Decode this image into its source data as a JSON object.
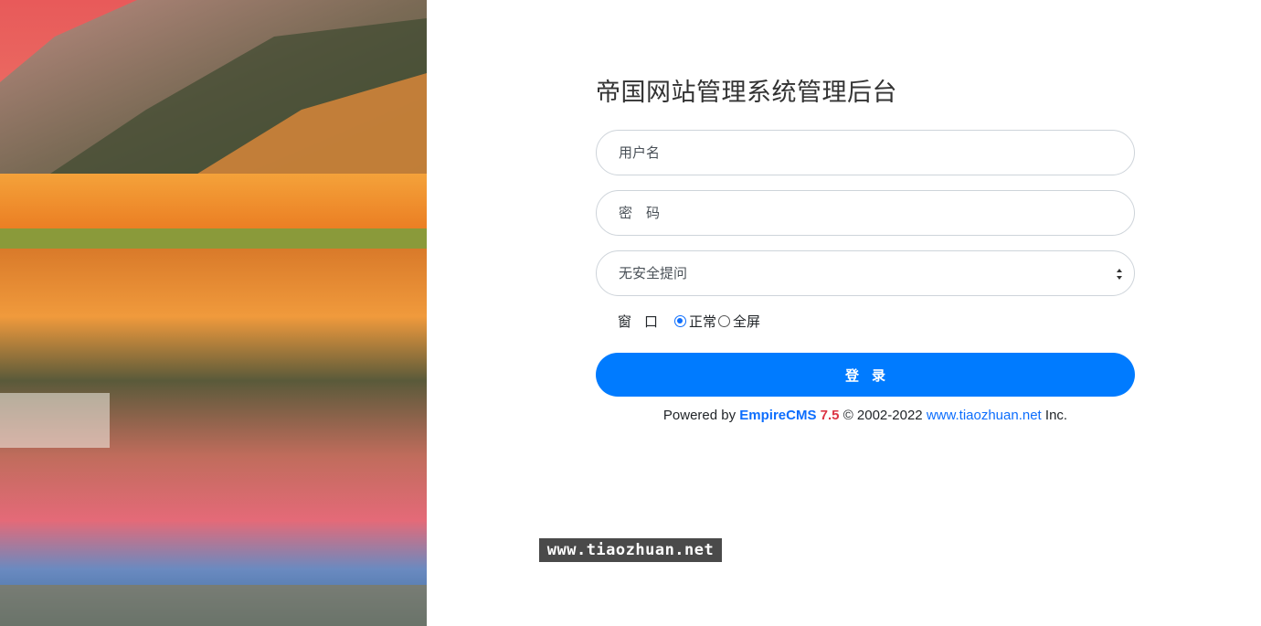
{
  "login": {
    "title": "帝国网站管理系统管理后台",
    "username_placeholder": "用户名",
    "password_placeholder": "密　码",
    "security_question": {
      "selected": "无安全提问"
    },
    "window_label": "窗口",
    "window_options": [
      {
        "label": "正常",
        "checked": true
      },
      {
        "label": "全屏",
        "checked": false
      }
    ],
    "submit_label": "登录"
  },
  "footer": {
    "powered_by": "Powered by",
    "brand": "EmpireCMS",
    "version": "7.5",
    "copyright": "© 2002-2022",
    "site_link": "www.tiaozhuan.net",
    "suffix": "Inc."
  },
  "watermark": "www.tiaozhuan.net",
  "colors": {
    "primary": "#007bff",
    "brand": "#0d6efd",
    "version": "#dc3545"
  }
}
